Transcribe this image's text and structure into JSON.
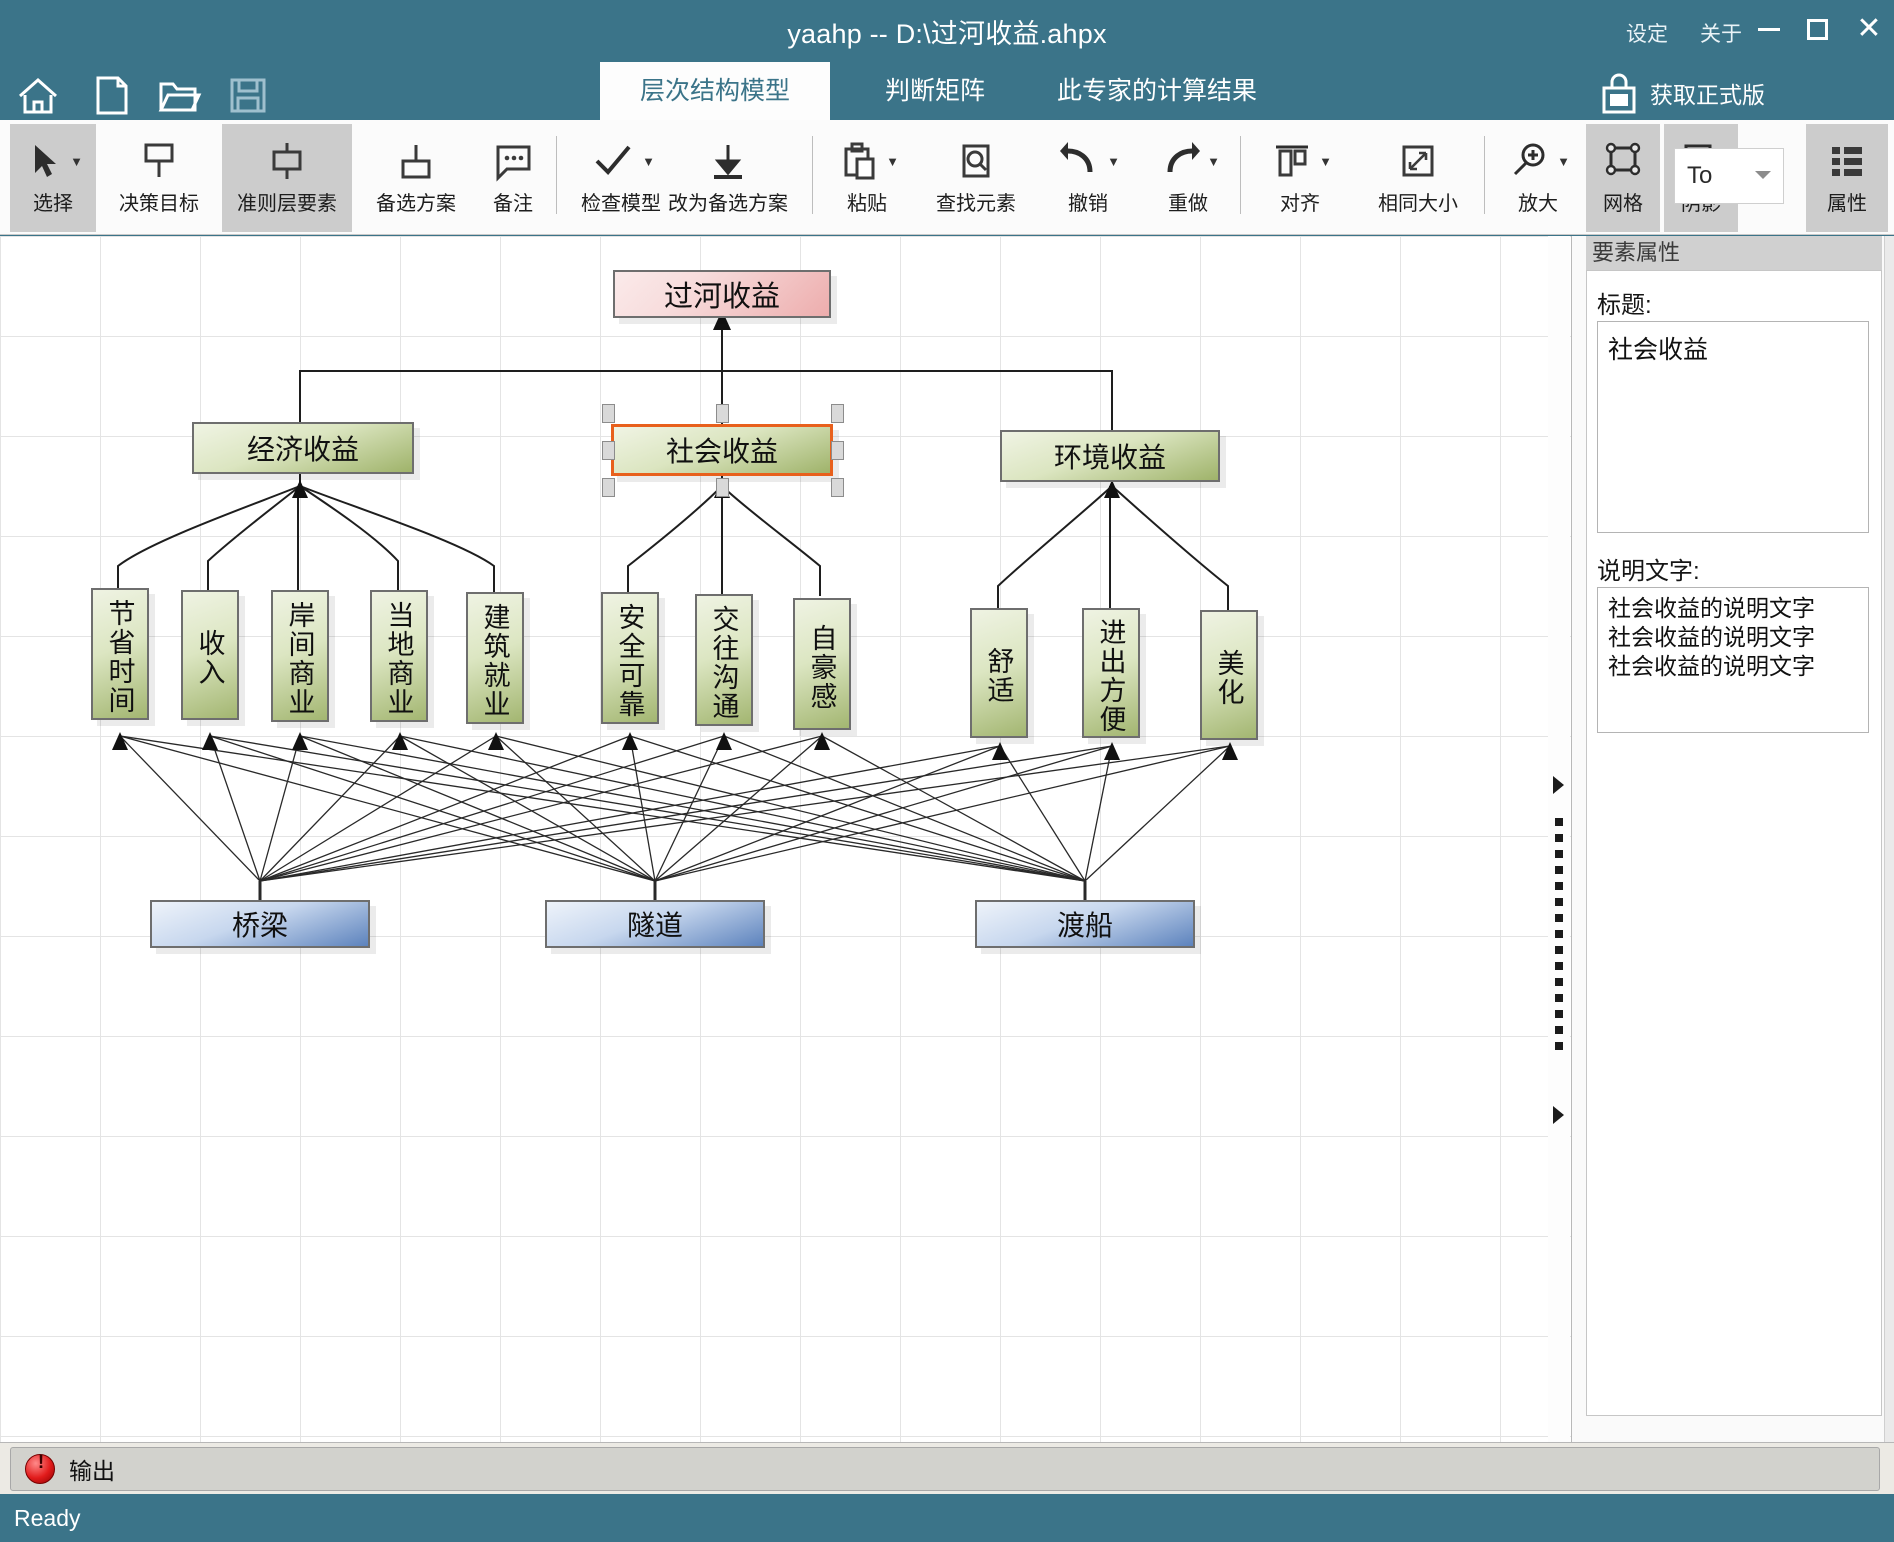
{
  "window": {
    "title": "yaahp  --  D:\\过河收益.ahpx",
    "menu": {
      "settings": "设定",
      "about": "关于"
    },
    "controls": {
      "minimize": "—",
      "maximize": "□",
      "close": "✕"
    }
  },
  "quick_access": [
    {
      "name": "home-icon",
      "label": "home"
    },
    {
      "name": "new-file-icon",
      "label": "new"
    },
    {
      "name": "open-folder-icon",
      "label": "open"
    },
    {
      "name": "save-icon",
      "label": "save"
    }
  ],
  "get_full_version": "获取正式版",
  "tabs": [
    {
      "label": "层次结构模型",
      "active": true
    },
    {
      "label": "判断矩阵",
      "active": false
    },
    {
      "label": "此专家的计算结果",
      "active": false
    }
  ],
  "ribbon": {
    "tools": [
      {
        "label": "选择",
        "icon": "cursor-arrow-icon",
        "pressed": true,
        "caret": true
      },
      {
        "label": "决策目标",
        "icon": "goal-node-icon",
        "pressed": false,
        "caret": false
      },
      {
        "label": "准则层要素",
        "icon": "criteria-node-icon",
        "pressed": true,
        "caret": false
      },
      {
        "label": "备选方案",
        "icon": "alternative-node-icon",
        "pressed": false,
        "caret": false
      },
      {
        "label": "备注",
        "icon": "comment-icon",
        "pressed": false,
        "caret": false
      },
      {
        "label": "检查模型",
        "icon": "check-icon",
        "pressed": false,
        "caret": true
      },
      {
        "label": "改为备选方案",
        "icon": "convert-down-icon",
        "pressed": false,
        "caret": false
      },
      {
        "label": "粘贴",
        "icon": "paste-icon",
        "pressed": false,
        "caret": true
      },
      {
        "label": "查找元素",
        "icon": "find-icon",
        "pressed": false,
        "caret": false
      },
      {
        "label": "撤销",
        "icon": "undo-arrow-icon",
        "pressed": false,
        "caret": true
      },
      {
        "label": "重做",
        "icon": "redo-arrow-icon",
        "pressed": false,
        "caret": true
      },
      {
        "label": "对齐",
        "icon": "align-icon",
        "pressed": false,
        "caret": true
      },
      {
        "label": "相同大小",
        "icon": "same-size-icon",
        "pressed": false,
        "caret": false
      },
      {
        "label": "放大",
        "icon": "zoom-in-icon",
        "pressed": false,
        "caret": true
      },
      {
        "label": "网格",
        "icon": "grid-icon",
        "pressed": true,
        "caret": false
      },
      {
        "label": "阴影",
        "icon": "shadow-icon",
        "pressed": true,
        "caret": false
      },
      {
        "label": "属性",
        "icon": "properties-list-icon",
        "pressed": true,
        "caret": false
      }
    ],
    "combo": {
      "value": "To"
    }
  },
  "properties_panel": {
    "header": "要素属性",
    "title_label": "标题:",
    "title_value": "社会收益",
    "desc_label": "说明文字:",
    "desc_value": "社会收益的说明文字\n社会收益的说明文字\n社会收益的说明文字"
  },
  "output": {
    "label": "输出",
    "icon": "error-badge-icon"
  },
  "status": {
    "text": "Ready"
  },
  "diagram": {
    "goal": {
      "label": "过河收益"
    },
    "criteria": [
      {
        "label": "经济收益",
        "selected": false
      },
      {
        "label": "社会收益",
        "selected": true
      },
      {
        "label": "环境收益",
        "selected": false
      }
    ],
    "sub_criteria": {
      "economic": [
        "节省时间",
        "收入",
        "岸间商业",
        "当地商业",
        "建筑就业"
      ],
      "social": [
        "安全可靠",
        "交往沟通",
        "自豪感"
      ],
      "environmental": [
        "舒适",
        "进出方便",
        "美化"
      ]
    },
    "alternatives": [
      "桥梁",
      "隧道",
      "渡船"
    ]
  },
  "colors": {
    "title_bar": "#3b7489",
    "goal_node": "#edadad",
    "criteria_node": "#9fb36a",
    "alternative_node": "#5d83bd",
    "selection": "#e8601c"
  }
}
